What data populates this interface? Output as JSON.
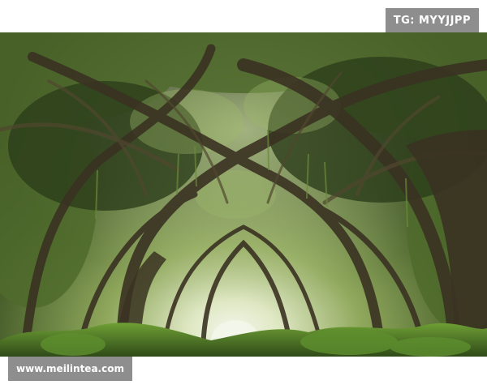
{
  "header": {
    "tag": "TG: MYYJJPP"
  },
  "footer": {
    "watermark": "www.meilintea.com"
  },
  "photo": {
    "subject": "tree-tunnel-forest",
    "colors": {
      "canopy_dark": "#1f2b14",
      "canopy_mid": "#4f6b2c",
      "canopy_light": "#9fbb6a",
      "trunk": "#3a3222",
      "light_opening": "#f3f6ea",
      "undergrowth": "#5e8f2e"
    }
  }
}
